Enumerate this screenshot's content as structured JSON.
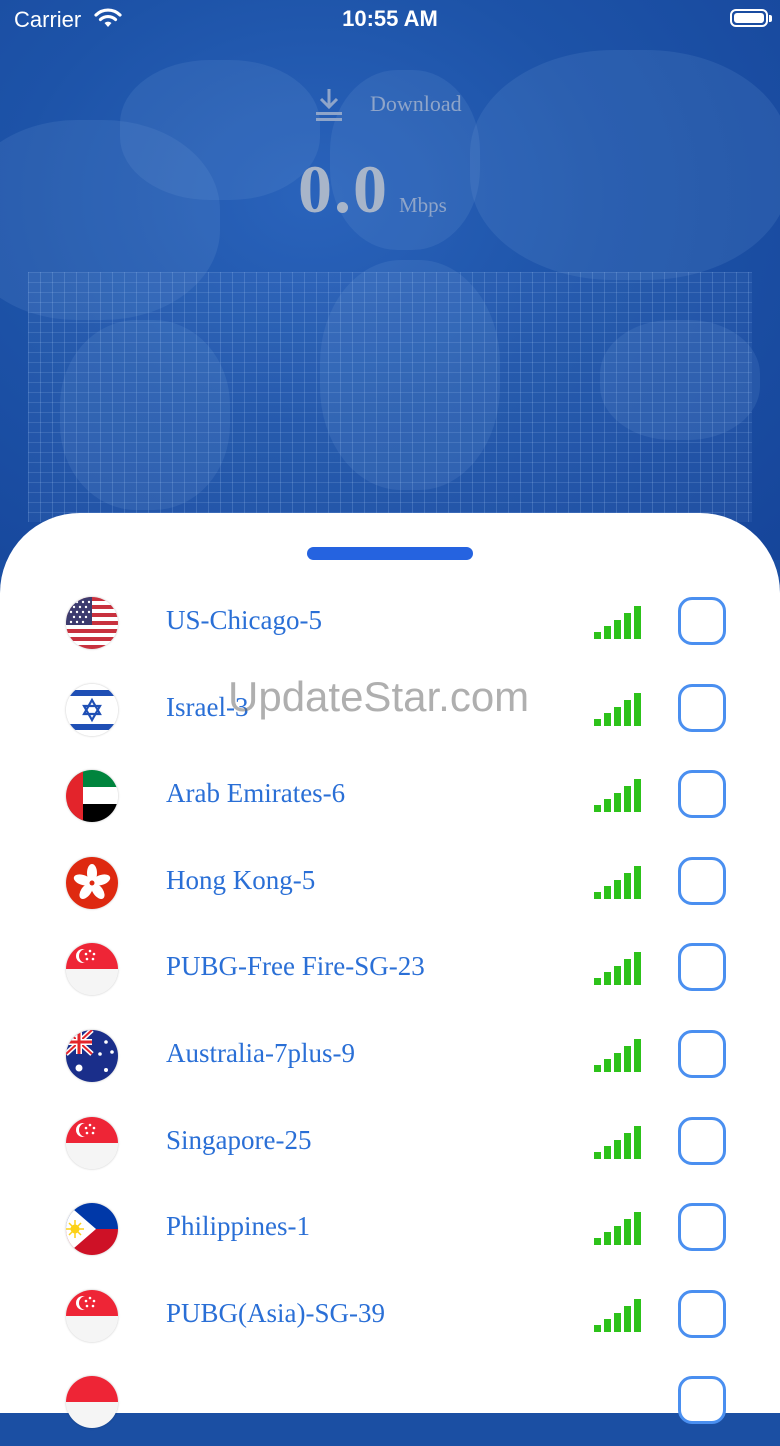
{
  "status_bar": {
    "carrier": "Carrier",
    "time": "10:55 AM"
  },
  "header": {
    "download_label": "Download",
    "download_icon": "download-icon",
    "speed_value": "0.0",
    "speed_unit": "Mbps"
  },
  "servers": [
    {
      "name": "US-Chicago-5",
      "flag": "us",
      "signal_bars": 5
    },
    {
      "name": "Israel-3",
      "flag": "il",
      "signal_bars": 5
    },
    {
      "name": "Arab Emirates-6",
      "flag": "ae",
      "signal_bars": 5
    },
    {
      "name": "Hong Kong-5",
      "flag": "hk",
      "signal_bars": 5
    },
    {
      "name": "PUBG-Free Fire-SG-23",
      "flag": "sg",
      "signal_bars": 5
    },
    {
      "name": "Australia-7plus-9",
      "flag": "au",
      "signal_bars": 5
    },
    {
      "name": "Singapore-25",
      "flag": "sg",
      "signal_bars": 5
    },
    {
      "name": "Philippines-1",
      "flag": "ph",
      "signal_bars": 5
    },
    {
      "name": "PUBG(Asia)-SG-39",
      "flag": "sg",
      "signal_bars": 5
    }
  ],
  "watermark": "UpdateStar.com",
  "colors": {
    "accent": "#2563e0",
    "signal": "#2dc21a",
    "server_text": "#2a6fd6",
    "header_bg": "#1b4fa3"
  }
}
